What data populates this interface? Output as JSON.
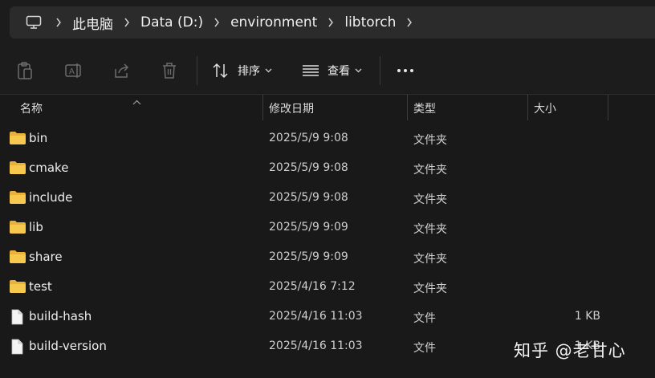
{
  "address_bar": {
    "crumbs": [
      "此电脑",
      "Data (D:)",
      "environment",
      "libtorch"
    ]
  },
  "toolbar": {
    "sort_label": "排序",
    "view_label": "查看"
  },
  "columns": {
    "name": "名称",
    "date": "修改日期",
    "type": "类型",
    "size": "大小"
  },
  "files": [
    {
      "name": "bin",
      "date": "2025/5/9 9:08",
      "type": "文件夹",
      "size": "",
      "kind": "folder"
    },
    {
      "name": "cmake",
      "date": "2025/5/9 9:08",
      "type": "文件夹",
      "size": "",
      "kind": "folder"
    },
    {
      "name": "include",
      "date": "2025/5/9 9:08",
      "type": "文件夹",
      "size": "",
      "kind": "folder"
    },
    {
      "name": "lib",
      "date": "2025/5/9 9:09",
      "type": "文件夹",
      "size": "",
      "kind": "folder"
    },
    {
      "name": "share",
      "date": "2025/5/9 9:09",
      "type": "文件夹",
      "size": "",
      "kind": "folder"
    },
    {
      "name": "test",
      "date": "2025/4/16 7:12",
      "type": "文件夹",
      "size": "",
      "kind": "folder"
    },
    {
      "name": "build-hash",
      "date": "2025/4/16 11:03",
      "type": "文件",
      "size": "1 KB",
      "kind": "file"
    },
    {
      "name": "build-version",
      "date": "2025/4/16 11:03",
      "type": "文件",
      "size": "1 KB",
      "kind": "file"
    }
  ],
  "watermark": "知乎 @老甘心",
  "colors": {
    "background": "#191919",
    "address_bg": "#2b2b2b",
    "folder": "#f0c04a",
    "text": "#efefef"
  }
}
